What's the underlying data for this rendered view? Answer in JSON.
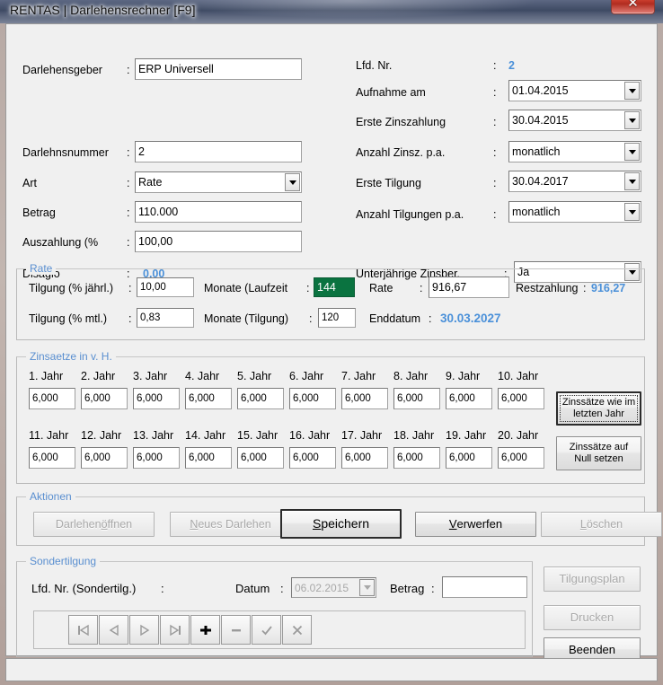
{
  "window": {
    "title": "RENTAS | Darlehensrechner [F9]",
    "close_label": "✕"
  },
  "left_form": {
    "fields": [
      {
        "label": "Darlehensgeber",
        "colon": ":",
        "value": "ERP Universell"
      },
      {
        "label": "Darlehnsnummer",
        "colon": ":",
        "value": "2"
      },
      {
        "label": "Art",
        "colon": ":",
        "value": "Rate"
      },
      {
        "label": "Betrag",
        "colon": ":",
        "value": "110.000"
      },
      {
        "label": "Auszahlung (%",
        "colon": ":",
        "value": "100,00"
      },
      {
        "label": "Disagio",
        "colon": ":",
        "value": "0,00"
      }
    ]
  },
  "right_form": {
    "fields": [
      {
        "label": "Lfd. Nr.",
        "colon": ":",
        "value": "2"
      },
      {
        "label": "Aufnahme am",
        "colon": ":",
        "value": "01.04.2015"
      },
      {
        "label": "Erste Zinszahlung",
        "colon": ":",
        "value": "30.04.2015"
      },
      {
        "label": "Anzahl Zinsz. p.a.",
        "colon": ":",
        "value": "monatlich"
      },
      {
        "label": "Erste Tilgung",
        "colon": ":",
        "value": "30.04.2017"
      },
      {
        "label": "Anzahl Tilgungen p.a.",
        "colon": ":",
        "value": "monatlich"
      },
      {
        "label": "Unterjährige Zinsber.",
        "colon": ":",
        "value": "Ja"
      }
    ]
  },
  "rate_group": {
    "caption": "Rate",
    "tilgung_jaehrl_label": "Tilgung (% jährl.)",
    "tilgung_jaehrl_colon": ":",
    "tilgung_jaehrl_value": "10,00",
    "monate_laufzeit_label": "Monate (Laufzeit",
    "monate_laufzeit_colon": ":",
    "monate_laufzeit_value": "144",
    "rate_label": "Rate",
    "rate_colon": ":",
    "rate_value": "916,67",
    "restzahlung_label": "Restzahlung",
    "restzahlung_colon": ":",
    "restzahlung_value": "916,27",
    "tilgung_mtl_label": "Tilgung (% mtl.)",
    "tilgung_mtl_colon": ":",
    "tilgung_mtl_value": "0,83",
    "monate_tilgung_label": "Monate (Tilgung)",
    "monate_tilgung_colon": ":",
    "monate_tilgung_value": "120",
    "enddatum_label": "Enddatum",
    "enddatum_colon": ":",
    "enddatum_value": "30.03.2027"
  },
  "zinssaetze_group": {
    "caption": "Zinsaetze in v. H.",
    "years": [
      {
        "label": "1. Jahr",
        "value": "6,000"
      },
      {
        "label": "2. Jahr",
        "value": "6,000"
      },
      {
        "label": "3. Jahr",
        "value": "6,000"
      },
      {
        "label": "4. Jahr",
        "value": "6,000"
      },
      {
        "label": "5. Jahr",
        "value": "6,000"
      },
      {
        "label": "6. Jahr",
        "value": "6,000"
      },
      {
        "label": "7. Jahr",
        "value": "6,000"
      },
      {
        "label": "8. Jahr",
        "value": "6,000"
      },
      {
        "label": "9. Jahr",
        "value": "6,000"
      },
      {
        "label": "10. Jahr",
        "value": "6,000"
      },
      {
        "label": "11. Jahr",
        "value": "6,000"
      },
      {
        "label": "12. Jahr",
        "value": "6,000"
      },
      {
        "label": "13. Jahr",
        "value": "6,000"
      },
      {
        "label": "14. Jahr",
        "value": "6,000"
      },
      {
        "label": "15. Jahr",
        "value": "6,000"
      },
      {
        "label": "16. Jahr",
        "value": "6,000"
      },
      {
        "label": "17. Jahr",
        "value": "6,000"
      },
      {
        "label": "18. Jahr",
        "value": "6,000"
      },
      {
        "label": "19. Jahr",
        "value": "6,000"
      },
      {
        "label": "20. Jahr",
        "value": "6,000"
      }
    ],
    "btn_like_last_line1": "Zinssätze wie im",
    "btn_like_last_line2": "letzten Jahr",
    "btn_zero_line1": "Zinssätze auf",
    "btn_zero_line2": "Null setzen"
  },
  "aktionen_group": {
    "caption": "Aktionen",
    "buttons": [
      {
        "pre": "Darlehen ",
        "accel": "ö",
        "post": "ffnen",
        "enabled": false
      },
      {
        "pre": "",
        "accel": "N",
        "post": "eues Darlehen",
        "enabled": false
      },
      {
        "pre": "",
        "accel": "S",
        "post": "peichern",
        "enabled": true
      },
      {
        "pre": "",
        "accel": "V",
        "post": "erwerfen",
        "enabled": true
      },
      {
        "pre": "",
        "accel": "L",
        "post": "öschen",
        "enabled": false
      }
    ]
  },
  "sondertilgung_group": {
    "caption": "Sondertilgung",
    "lfd_nr_label": "Lfd. Nr. (Sondertilg.)",
    "lfd_nr_colon": ":",
    "datum_label": "Datum",
    "datum_colon": ":",
    "datum_value": "06.02.2015",
    "betrag_label": "Betrag",
    "betrag_colon": ":",
    "betrag_value": ""
  },
  "navigator": {
    "buttons": [
      {
        "name": "first-record",
        "glyph": "first"
      },
      {
        "name": "prior-record",
        "glyph": "prior"
      },
      {
        "name": "next-record",
        "glyph": "next"
      },
      {
        "name": "last-record",
        "glyph": "last"
      },
      {
        "name": "insert-record",
        "glyph": "plus"
      },
      {
        "name": "delete-record",
        "glyph": "minus"
      },
      {
        "name": "post-edit",
        "glyph": "check"
      },
      {
        "name": "cancel-edit",
        "glyph": "cross"
      }
    ]
  },
  "side_buttons": {
    "tilgungsplan": "Tilgungsplan",
    "drucken": "Drucken",
    "beenden": "Beenden"
  },
  "colors": {
    "accent_blue": "#4a90d9",
    "group_caption": "#5a8fd0",
    "highlight_green": "#0a7340",
    "form_bg": "#f0f0f0",
    "close_red": "#c73b2c"
  }
}
